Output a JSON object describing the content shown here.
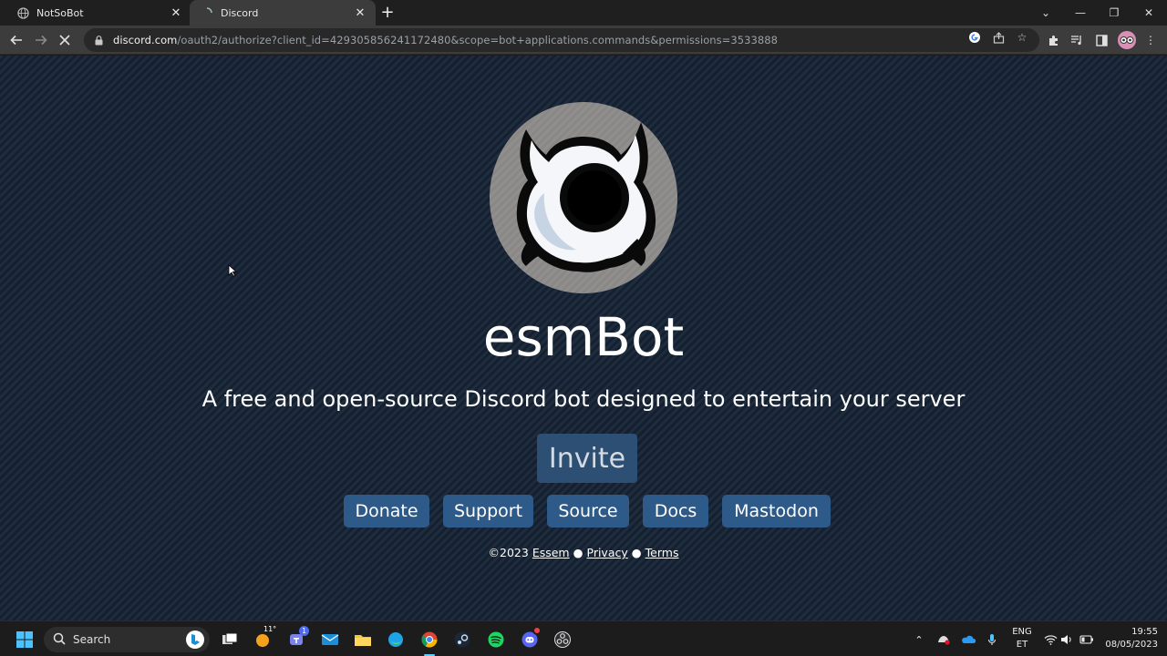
{
  "browser": {
    "tabs": [
      {
        "title": "NotSoBot"
      },
      {
        "title": "Discord"
      }
    ],
    "url_host": "discord.com",
    "url_path": "/oauth2/authorize?client_id=429305856241172480&scope=bot+applications.commands&permissions=3533888"
  },
  "page": {
    "bot_name": "esmBot",
    "tagline": "A free and open-source Discord bot designed to entertain your server",
    "invite_label": "Invite",
    "links": [
      "Donate",
      "Support",
      "Source",
      "Docs",
      "Mastodon"
    ],
    "footer": {
      "copyright": "©2023",
      "author": "Essem",
      "sep": "●",
      "privacy": "Privacy",
      "terms": "Terms"
    },
    "colors": {
      "background": "#1b2838",
      "button": "#2d5a88",
      "invite_button": "#2d4f73"
    }
  },
  "taskbar": {
    "search_label": "Search",
    "weather": "11°",
    "teams_badge": "1",
    "lang_line1": "ENG",
    "lang_line2": "ET",
    "time": "19:55",
    "date": "08/05/2023"
  }
}
